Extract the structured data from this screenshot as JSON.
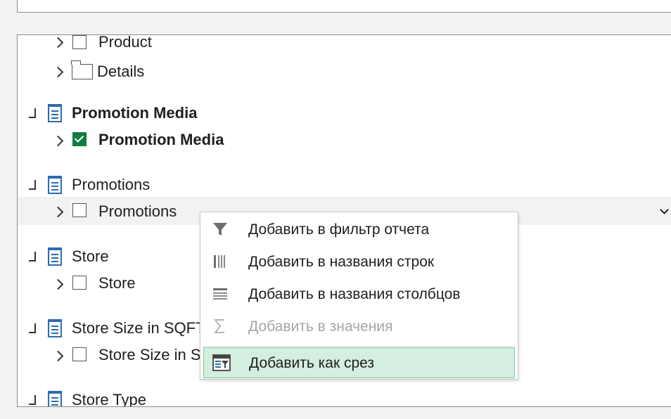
{
  "tree": {
    "items": [
      {
        "label": "Product"
      },
      {
        "label": "Details"
      },
      {
        "table_label": "Promotion Media",
        "field_label": "Promotion Media",
        "checked": true
      },
      {
        "table_label": "Promotions",
        "field_label": "Promotions",
        "checked": false
      },
      {
        "table_label": "Store",
        "field_label": "Store",
        "checked": false
      },
      {
        "table_label": "Store Size in SQFT",
        "field_label": "Store Size in S",
        "checked": false
      },
      {
        "table_label": "Store Type"
      }
    ]
  },
  "context_menu": {
    "items": [
      {
        "label": "Добавить в фильтр отчета",
        "icon": "filter-icon",
        "enabled": true
      },
      {
        "label": "Добавить в названия строк",
        "icon": "rows-icon",
        "enabled": true
      },
      {
        "label": "Добавить в названия столбцов",
        "icon": "columns-icon",
        "enabled": true
      },
      {
        "label": "Добавить в значения",
        "icon": "sigma-icon",
        "enabled": false
      },
      {
        "label": "Добавить как срез",
        "icon": "slicer-icon",
        "enabled": true,
        "hovered": true
      }
    ]
  },
  "colors": {
    "accent_green": "#107c41",
    "table_icon_blue": "#2b6cb0",
    "hover_bg": "#d4eedf"
  }
}
